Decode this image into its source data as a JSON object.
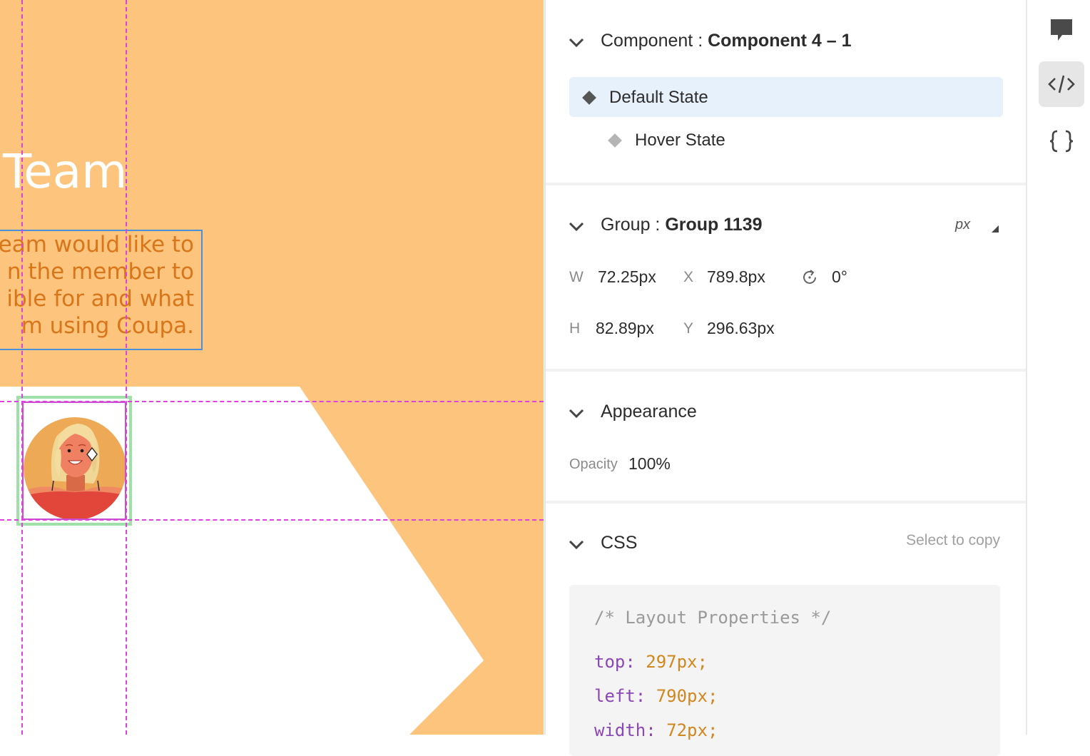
{
  "canvas": {
    "title_fragment": "Team",
    "body_lines": [
      "eam would like to",
      "n the member to",
      "ible for and what",
      "m using Coupa."
    ]
  },
  "component": {
    "prefix": "Component : ",
    "name": "Component 4 – 1",
    "states": [
      {
        "label": "Default State",
        "selected": true
      },
      {
        "label": "Hover State",
        "selected": false
      }
    ]
  },
  "group": {
    "prefix": "Group : ",
    "name": "Group 1139",
    "unit": "px",
    "w_label": "W",
    "w_value": "72.25px",
    "x_label": "X",
    "x_value": "789.8px",
    "rotation_value": "0°",
    "h_label": "H",
    "h_value": "82.89px",
    "y_label": "Y",
    "y_value": "296.63px"
  },
  "appearance": {
    "title": "Appearance",
    "opacity_label": "Opacity",
    "opacity_value": "100%"
  },
  "css": {
    "title": "CSS",
    "copy_hint": "Select to copy",
    "comment": "/* Layout Properties */",
    "lines": [
      {
        "prop": "top:",
        "value": "297px;"
      },
      {
        "prop": "left:",
        "value": "790px;"
      },
      {
        "prop": "width:",
        "value": "72px;"
      }
    ]
  },
  "rail": {
    "items": [
      {
        "icon": "comment-icon",
        "active": false
      },
      {
        "icon": "code-icon",
        "active": true
      },
      {
        "icon": "braces-icon",
        "active": false
      }
    ]
  },
  "colors": {
    "canvas_bg": "#fdc47e",
    "selected_state_bg": "#e6f1fb",
    "guide": "#e040e0",
    "hover_frame": "#9fe0a8",
    "code_property": "#8b47b8",
    "code_value": "#d2871e"
  }
}
